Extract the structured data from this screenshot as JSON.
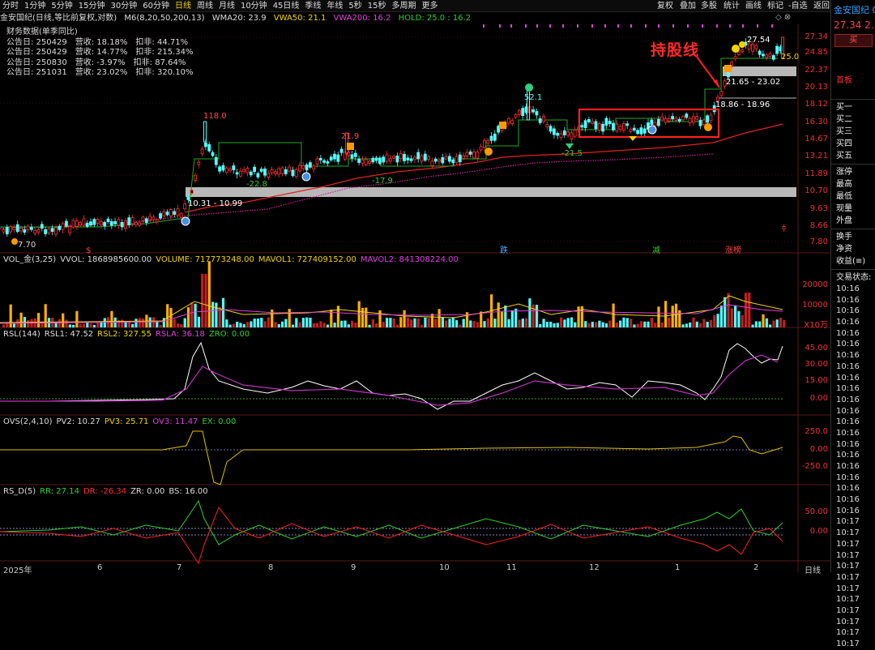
{
  "toolbar": {
    "periods": [
      "分时",
      "1分钟",
      "5分钟",
      "15分钟",
      "30分钟",
      "60分钟",
      "日线",
      "周线",
      "月线",
      "10分钟",
      "45日线",
      "季线",
      "年线",
      "5秒",
      "15秒",
      "多周期",
      "更多"
    ],
    "active_index": 6,
    "right_items": [
      "复权",
      "叠加",
      "多股",
      "统计",
      "画线",
      "标记",
      "-自选",
      "返回"
    ]
  },
  "infobar": {
    "stock": "金安国纪(日线,等比前复权,对数)",
    "ma": "M6(8,20,50,200,13)",
    "wma20": "WMA20: 23.9",
    "vwa50": "VWA50: 21.1",
    "vwa200": "VWA200: 16.2",
    "hold": "HOLD: 25.0 : 16.2"
  },
  "financial": {
    "title": "财务数据(单季同比)",
    "rows": [
      {
        "date": "公告日: 250429",
        "rev": "营收:  18.18%",
        "profit": "扣非:  44.71%"
      },
      {
        "date": "公告日: 250429",
        "rev": "营收:  14.77%",
        "profit": "扣非:  215.34%"
      },
      {
        "date": "公告日: 250830",
        "rev": "营收:  -3.97%",
        "profit": "扣非:  87.64%"
      },
      {
        "date": "公告日: 251031",
        "rev": "营收:  23.02%",
        "profit": "扣非:  320.10%"
      }
    ]
  },
  "annotation": "持股线",
  "price_labels": {
    "high_118": "118.0",
    "p219": "21.9",
    "p521": "52.1",
    "m228": "-22.8",
    "m179": "-17.9",
    "m215": "-21.5",
    "low": "7.70",
    "top": "27.54",
    "hold25": "25.0",
    "zone1": "10.31 - 10.99",
    "zone2": "21.65 - 23.02",
    "zone3": "18.86 - 18.96"
  },
  "y_axis_main": [
    "27.34",
    "24.85",
    "22.37",
    "20.13",
    "18.12",
    "16.30",
    "14.67",
    "13.21",
    "11.89",
    "10.70",
    "9.63",
    "8.66",
    "7.80"
  ],
  "events": [
    "$",
    "跌",
    "减",
    "涨榜"
  ],
  "vol_panel": {
    "title": "VOL_金(3,25)",
    "vvol": "VVOL: 1868985600.00",
    "volume": "VOLUME: 717773248.00",
    "mavol1": "MAVOL1: 727409152.00",
    "mavol2": "MAVOL2: 841308224.00",
    "ticks": [
      "20000",
      "10000"
    ],
    "unit": "X10万"
  },
  "rsl_panel": {
    "title": "RSL(144)",
    "rsl1": "RSL1: 47.52",
    "rsl2": "RSL2: 327.55",
    "rsla": "RSLA: 36.18",
    "zro": "ZRO: 0.00",
    "ticks": [
      "45.00",
      "30.00",
      "15.00",
      "0.00"
    ]
  },
  "ovs_panel": {
    "title": "OVS(2,4,10)",
    "pv2": "PV2: 10.27",
    "pv3": "PV3: 25.71",
    "ov3": "OV3: 11.47",
    "ex": "EX: 0.00",
    "ticks": [
      "250.0",
      "0.00",
      "-250.0"
    ]
  },
  "rsd_panel": {
    "title": "RS_D(5)",
    "rr": "RR: 27.14",
    "dr": "DR: -26.34",
    "zr": "ZR: 0.00",
    "bs": "BS: 16.00",
    "ticks": [
      "50.00",
      "0.00"
    ]
  },
  "x_axis": [
    "2025年",
    "6",
    "7",
    "8",
    "9",
    "10",
    "11",
    "12",
    "1",
    "2"
  ],
  "x_axis_right": "日线",
  "right_panel": {
    "name": "金安国纪 0",
    "price": "27.34  2.",
    "buy": "买",
    "board": "首板",
    "bids": [
      "买一",
      "买二",
      "买三",
      "买四",
      "买五"
    ],
    "stats": [
      "涨停",
      "最高",
      "最低",
      "现量",
      "外盘"
    ],
    "stats2": [
      "换手",
      "净资",
      "收益(≡)"
    ],
    "status": "交易状态: ",
    "times": [
      "10:16",
      "10:16",
      "10:16",
      "10:16",
      "10:16",
      "10:16",
      "10:16",
      "10:16",
      "10:16",
      "10:16",
      "10:16",
      "10:16",
      "10:16",
      "10:16",
      "10:16",
      "10:16",
      "10:16",
      "10:16",
      "10:16",
      "10:16",
      "10:16",
      "10:17",
      "10:17",
      "10:17",
      "10:17",
      "10:17",
      "10:17",
      "10:17",
      "10:17",
      "10:17",
      "10:17",
      "10:17",
      "10:17"
    ]
  },
  "colors": {
    "up": "#ff3030",
    "down": "#54ffff",
    "yellow": "#f5d300",
    "magenta": "#e040e0",
    "green": "#2fd02f",
    "red": "#ff2020",
    "orange": "#ffa500"
  }
}
